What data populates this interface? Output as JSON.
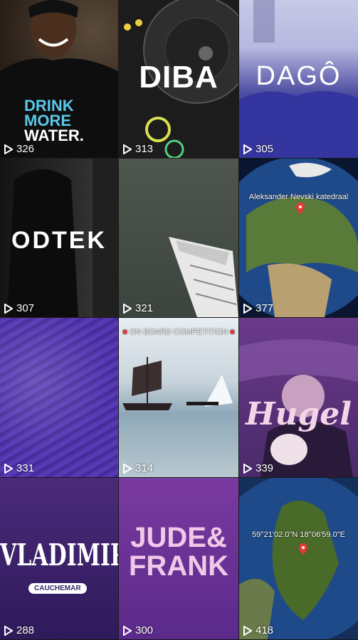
{
  "tiles": [
    {
      "id": "t1",
      "views": "326",
      "shirt_lines": [
        "DRINK",
        "MORE",
        "WATER."
      ]
    },
    {
      "id": "t2",
      "views": "313",
      "overlay": "DIBA"
    },
    {
      "id": "t3",
      "views": "305",
      "overlay": "DAGÔ"
    },
    {
      "id": "t4",
      "views": "307",
      "overlay": "ODTEK"
    },
    {
      "id": "t5",
      "views": "321"
    },
    {
      "id": "t6",
      "views": "377",
      "map_label": "Aleksander Nevski katedraal"
    },
    {
      "id": "t7",
      "views": "331"
    },
    {
      "id": "t8",
      "views": "314",
      "banner": "ON BOARD COMPETITION"
    },
    {
      "id": "t9",
      "views": "339",
      "overlay": "Hugel"
    },
    {
      "id": "t10",
      "views": "288",
      "overlay": "VLADIMIR",
      "sub": "CAUCHEMAR"
    },
    {
      "id": "t11",
      "views": "300",
      "overlay_lines": [
        "JUDE&",
        "FRANK"
      ]
    },
    {
      "id": "t12",
      "views": "418",
      "map_label": "59°21'02.0\"N 18°06'59.0\"E"
    }
  ],
  "icons": {
    "play": "play-icon",
    "pin": "map-pin-icon",
    "emoji": "siren-emoji"
  },
  "colors": {
    "gridline": "#1a1a1a",
    "purple": "#6b3fb0",
    "text": "#ffffff"
  }
}
